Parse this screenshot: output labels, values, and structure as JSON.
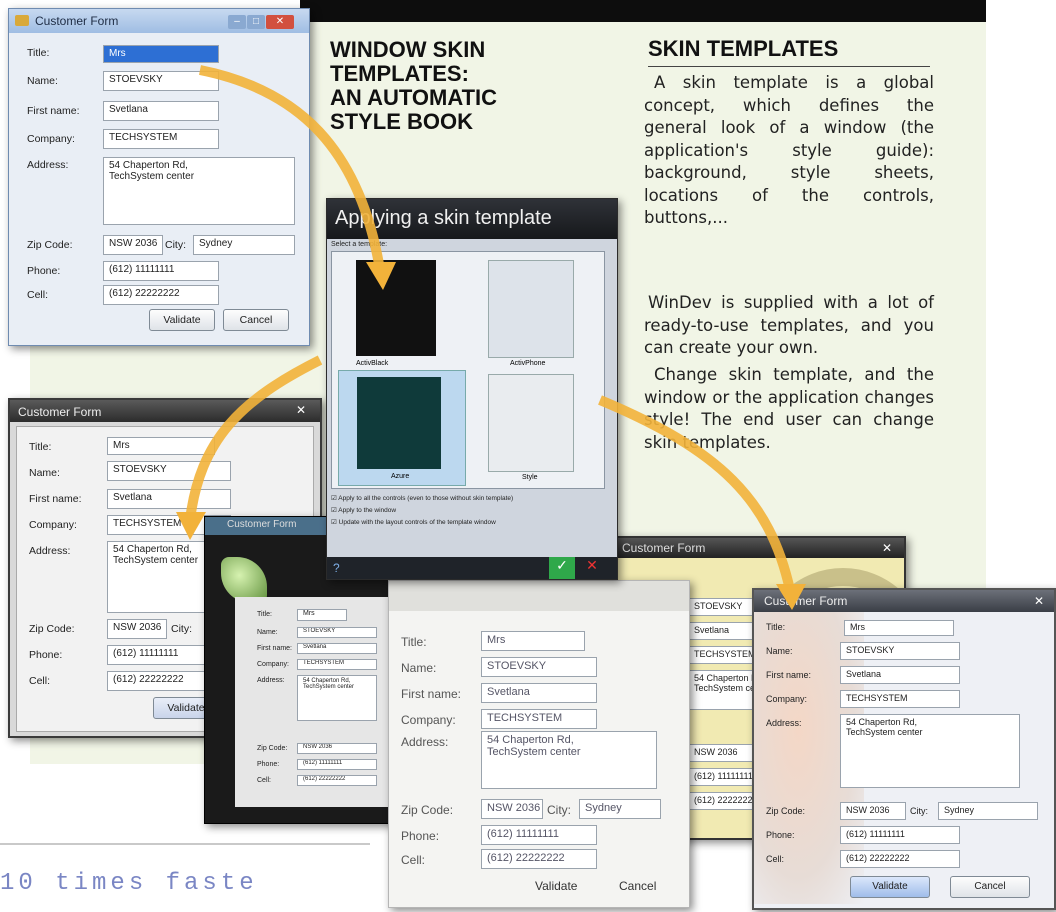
{
  "headline": {
    "left": [
      "WINDOW SKIN",
      "TEMPLATES:",
      "AN AUTOMATIC",
      "STYLE BOOK"
    ],
    "right": "SKIN TEMPLATES"
  },
  "paragraphs": [
    "A skin template is a global concept, which defines the general look of a window (the application's style guide): background, style sheets, locations of the controls, buttons,...",
    "WinDev is supplied with a lot of ready-to-use templates, and you can create your own.",
    "Change skin template, and the window or the application changes style! The end user can change skin templates."
  ],
  "footer": "10 times faste",
  "form": {
    "title": "Customer Form",
    "labels": {
      "title": "Title:",
      "name": "Name:",
      "first_name": "First name:",
      "company": "Company:",
      "address": "Address:",
      "zip": "Zip Code:",
      "city": "City:",
      "phone": "Phone:",
      "cell": "Cell:"
    },
    "values": {
      "title": "Mrs",
      "name": "STOEVSKY",
      "first_name": "Svetlana",
      "company": "TECHSYSTEM",
      "address_line1": "54 Chaperton Rd,",
      "address_line2": "TechSystem center",
      "zip": "NSW 2036",
      "city": "Sydney",
      "phone": "(612) 11111111",
      "cell": "(612) 22222222"
    },
    "buttons": {
      "validate": "Validate",
      "cancel": "Cancel"
    }
  },
  "dialog": {
    "title": "Applying a skin template",
    "select_label": "Select a template:",
    "templates": [
      "ActivBlack",
      "ActivPhone",
      "Azure",
      "Style"
    ],
    "checkboxes": [
      "Apply to all the controls (even to those without skin template)",
      "Apply to the window",
      "Update with the layout controls of the template window"
    ]
  },
  "colors": {
    "arrow": "#f2b23a",
    "panel": "#f1f5e6",
    "footer": "#7a86c4",
    "blue_title": "#1a5fb4"
  }
}
